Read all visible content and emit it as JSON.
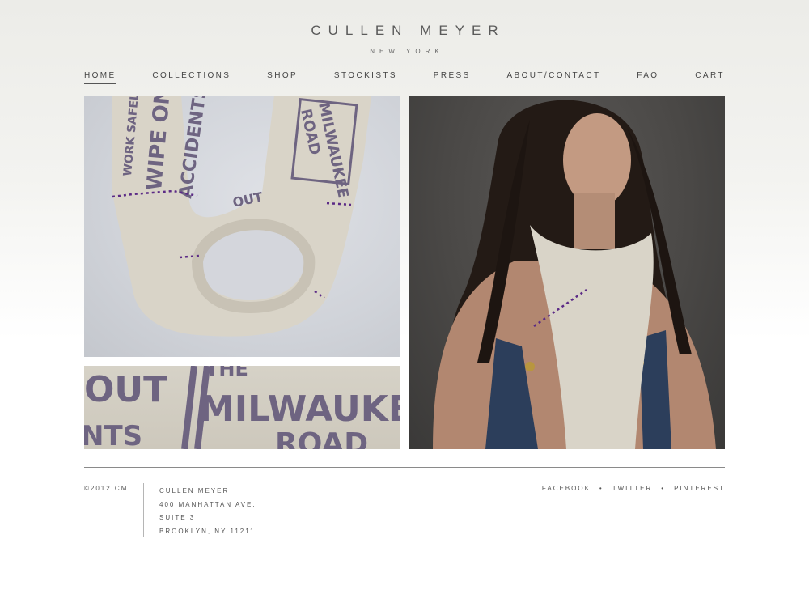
{
  "brand": {
    "name": "CULLEN MEYER",
    "location": "NEW YORK"
  },
  "nav": {
    "items": [
      {
        "label": "HOME",
        "active": true
      },
      {
        "label": "COLLECTIONS"
      },
      {
        "label": "SHOP"
      },
      {
        "label": "STOCKISTS"
      },
      {
        "label": "PRESS"
      },
      {
        "label": "ABOUT/CONTACT"
      },
      {
        "label": "FAQ"
      },
      {
        "label": "CART"
      }
    ]
  },
  "images": {
    "scarf_print": {
      "lines": [
        "WORK SAFELY",
        "WIPE ON",
        "ACCIDENTS",
        "MILWAUKEE",
        "ROAD",
        "OUT"
      ]
    },
    "detail_print": {
      "lines": [
        "OUT",
        "NTS",
        "THE",
        "MILWAUKE",
        "ROAD"
      ]
    }
  },
  "footer": {
    "copyright": "©2012 CM",
    "address": [
      "CULLEN MEYER",
      "400 MANHATTAN AVE.",
      "SUITE 3",
      "BROOKLYN, NY 11211"
    ],
    "social": [
      "FACEBOOK",
      "TWITTER",
      "PINTEREST"
    ],
    "separator": "•"
  },
  "colors": {
    "print_ink": "#6e6481",
    "stitch": "#5b2a86",
    "fabric": "#d9d4c8",
    "denim": "#2c3e5b"
  }
}
